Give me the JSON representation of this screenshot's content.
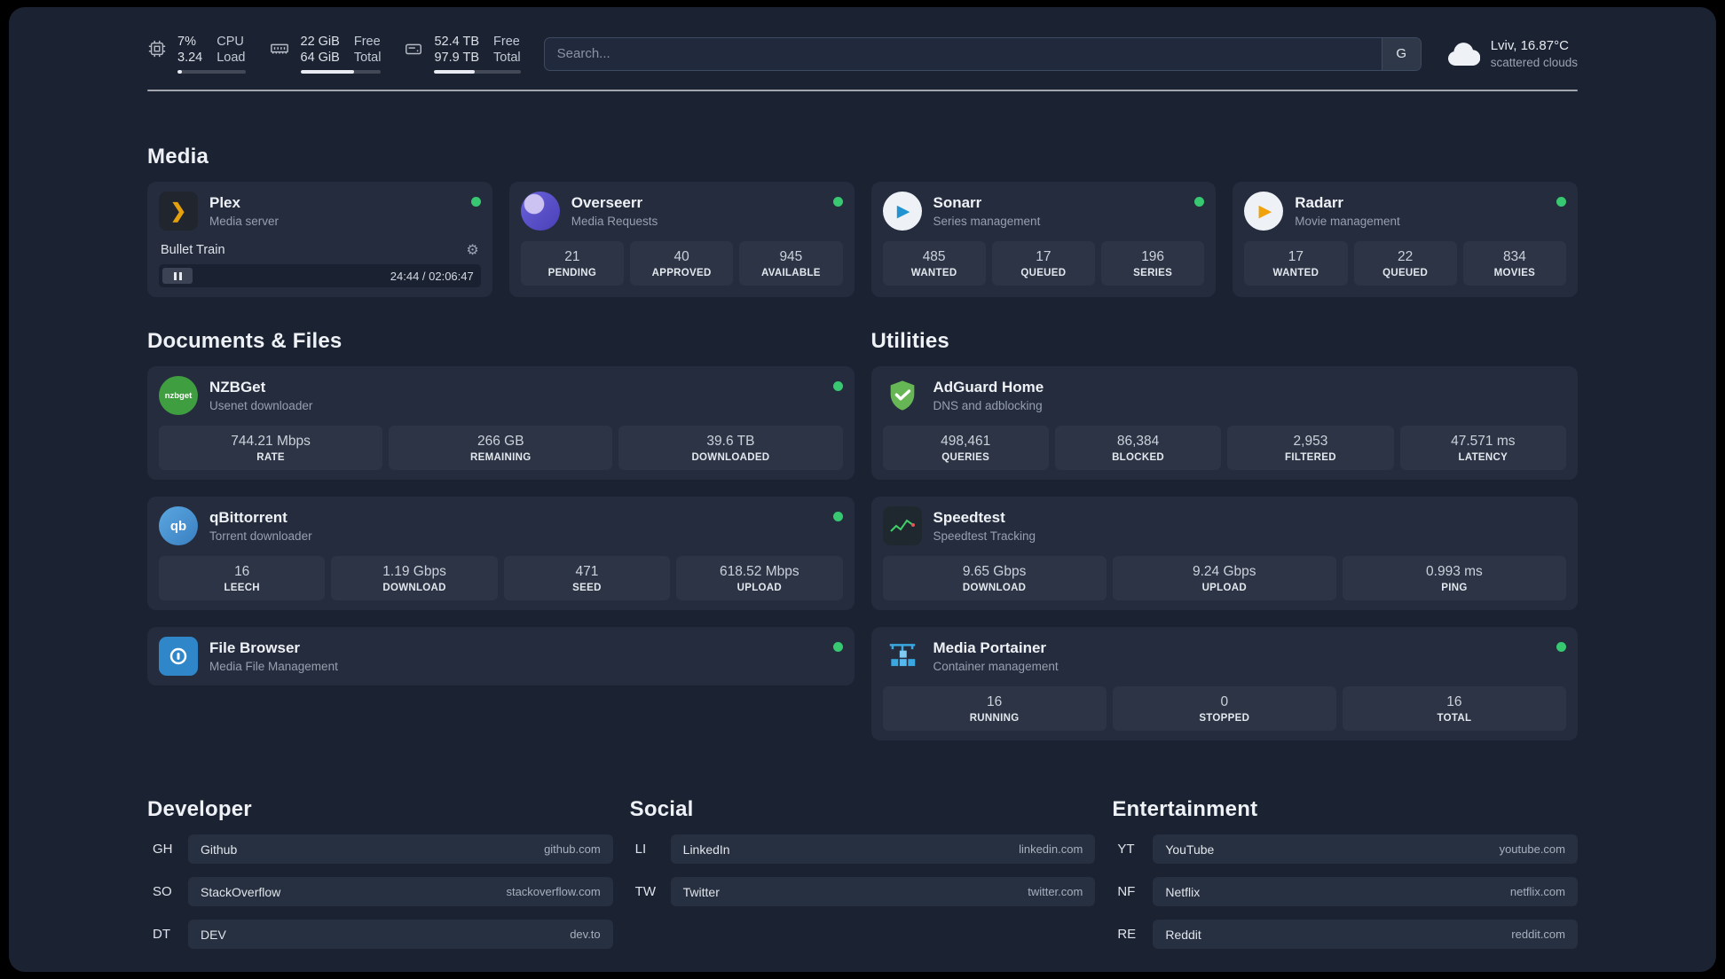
{
  "topbar": {
    "cpu": {
      "value_top": "7%",
      "value_bottom": "3.24",
      "label_top": "CPU",
      "label_bottom": "Load",
      "bar_percent": 7
    },
    "ram": {
      "value_top": "22 GiB",
      "value_bottom": "64 GiB",
      "label_top": "Free",
      "label_bottom": "Total",
      "bar_percent": 66
    },
    "disk": {
      "value_top": "52.4 TB",
      "value_bottom": "97.9 TB",
      "label_top": "Free",
      "label_bottom": "Total",
      "bar_percent": 47
    },
    "search": {
      "placeholder": "Search...",
      "engine_button": "G"
    },
    "weather": {
      "location": "Lviv, 16.87°C",
      "condition": "scattered clouds"
    }
  },
  "media": {
    "title": "Media",
    "plex": {
      "name": "Plex",
      "desc": "Media server",
      "now_playing": {
        "title": "Bullet Train",
        "time": "24:44 / 02:06:47"
      }
    },
    "overseerr": {
      "name": "Overseerr",
      "desc": "Media Requests",
      "stats": [
        {
          "value": "21",
          "label": "PENDING"
        },
        {
          "value": "40",
          "label": "APPROVED"
        },
        {
          "value": "945",
          "label": "AVAILABLE"
        }
      ]
    },
    "sonarr": {
      "name": "Sonarr",
      "desc": "Series management",
      "stats": [
        {
          "value": "485",
          "label": "WANTED"
        },
        {
          "value": "17",
          "label": "QUEUED"
        },
        {
          "value": "196",
          "label": "SERIES"
        }
      ]
    },
    "radarr": {
      "name": "Radarr",
      "desc": "Movie management",
      "stats": [
        {
          "value": "17",
          "label": "WANTED"
        },
        {
          "value": "22",
          "label": "QUEUED"
        },
        {
          "value": "834",
          "label": "MOVIES"
        }
      ]
    }
  },
  "documents": {
    "title": "Documents & Files",
    "nzbget": {
      "name": "NZBGet",
      "desc": "Usenet downloader",
      "icon_text": "nzbget",
      "stats": [
        {
          "value": "744.21 Mbps",
          "label": "RATE"
        },
        {
          "value": "266 GB",
          "label": "REMAINING"
        },
        {
          "value": "39.6 TB",
          "label": "DOWNLOADED"
        }
      ]
    },
    "qbittorrent": {
      "name": "qBittorrent",
      "desc": "Torrent downloader",
      "icon_text": "qb",
      "stats": [
        {
          "value": "16",
          "label": "LEECH"
        },
        {
          "value": "1.19 Gbps",
          "label": "DOWNLOAD"
        },
        {
          "value": "471",
          "label": "SEED"
        },
        {
          "value": "618.52 Mbps",
          "label": "UPLOAD"
        }
      ]
    },
    "filebrowser": {
      "name": "File Browser",
      "desc": "Media File Management"
    }
  },
  "utilities": {
    "title": "Utilities",
    "adguard": {
      "name": "AdGuard Home",
      "desc": "DNS and adblocking",
      "stats": [
        {
          "value": "498,461",
          "label": "QUERIES"
        },
        {
          "value": "86,384",
          "label": "BLOCKED"
        },
        {
          "value": "2,953",
          "label": "FILTERED"
        },
        {
          "value": "47.571 ms",
          "label": "LATENCY"
        }
      ]
    },
    "speedtest": {
      "name": "Speedtest",
      "desc": "Speedtest Tracking",
      "stats": [
        {
          "value": "9.65 Gbps",
          "label": "DOWNLOAD"
        },
        {
          "value": "9.24 Gbps",
          "label": "UPLOAD"
        },
        {
          "value": "0.993 ms",
          "label": "PING"
        }
      ]
    },
    "portainer": {
      "name": "Media Portainer",
      "desc": "Container management",
      "stats": [
        {
          "value": "16",
          "label": "RUNNING"
        },
        {
          "value": "0",
          "label": "STOPPED"
        },
        {
          "value": "16",
          "label": "TOTAL"
        }
      ]
    }
  },
  "bookmarks": [
    {
      "title": "Developer",
      "links": [
        {
          "abbr": "GH",
          "name": "Github",
          "domain": "github.com"
        },
        {
          "abbr": "SO",
          "name": "StackOverflow",
          "domain": "stackoverflow.com"
        },
        {
          "abbr": "DT",
          "name": "DEV",
          "domain": "dev.to"
        }
      ]
    },
    {
      "title": "Social",
      "links": [
        {
          "abbr": "LI",
          "name": "LinkedIn",
          "domain": "linkedin.com"
        },
        {
          "abbr": "TW",
          "name": "Twitter",
          "domain": "twitter.com"
        }
      ]
    },
    {
      "title": "Entertainment",
      "links": [
        {
          "abbr": "YT",
          "name": "YouTube",
          "domain": "youtube.com"
        },
        {
          "abbr": "NF",
          "name": "Netflix",
          "domain": "netflix.com"
        },
        {
          "abbr": "RE",
          "name": "Reddit",
          "domain": "reddit.com"
        }
      ]
    }
  ]
}
